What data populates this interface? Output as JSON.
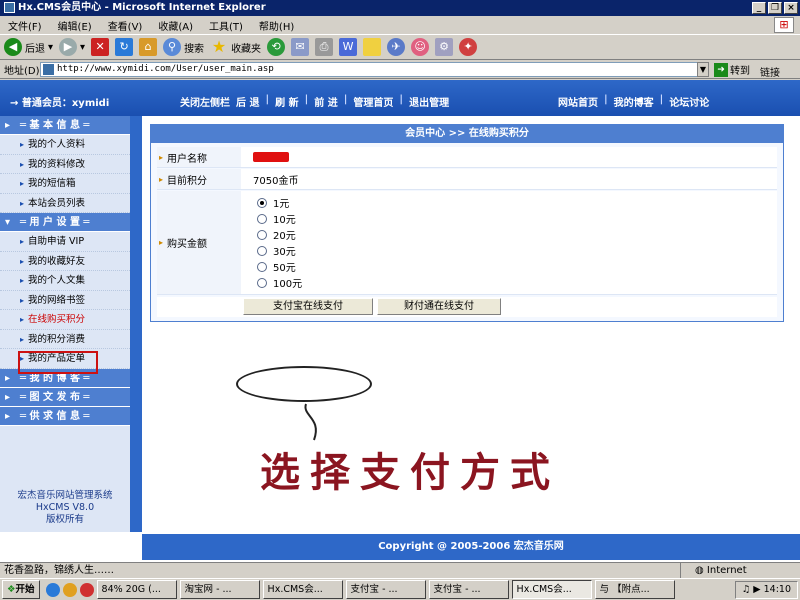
{
  "browser": {
    "title": "Hx.CMS会员中心 - Microsoft Internet Explorer",
    "menus": [
      "文件(F)",
      "编辑(E)",
      "查看(V)",
      "收藏(A)",
      "工具(T)",
      "帮助(H)"
    ],
    "toolbar": {
      "back": "后退",
      "search": "搜索",
      "favorites": "收藏夹"
    },
    "address_label": "地址(D)",
    "address": "http://www.xymidi.com/User/user_main.asp",
    "go": "转到",
    "links": "链接",
    "status": "花香盈路，锦绣人生……",
    "zone": "Internet"
  },
  "site": {
    "user_label": "→ 普通会员：xymidi",
    "nav_center": [
      "关闭左侧栏",
      "后 退",
      "刷 新",
      "前 进",
      "管理首页",
      "退出管理"
    ],
    "nav_right": [
      "网站首页",
      "我的博客",
      "论坛讨论"
    ],
    "sidebar": {
      "sections": [
        {
          "title": "═ 基 本 信 息 ═",
          "items": [
            "我的个人资料",
            "我的资料修改",
            "我的短信箱",
            "本站会员列表"
          ]
        },
        {
          "title": "═ 用 户 设 置 ═",
          "items": [
            "自助申请 VIP",
            "我的收藏好友",
            "我的个人文集",
            "我的网络书签",
            "在线购买积分",
            "我的积分消费",
            "我的产品定单"
          ]
        },
        {
          "title": "═ 我 的 博 客 ═",
          "items": []
        },
        {
          "title": "═ 图 文 发 布 ═",
          "items": []
        },
        {
          "title": "═ 供 求 信 息 ═",
          "items": []
        }
      ],
      "credits": [
        "宏杰音乐网站管理系统",
        "HxCMS V8.0",
        "版权所有"
      ]
    },
    "main": {
      "header": "会员中心 >> 在线购买积分",
      "username_label": "用户名称",
      "points_label": "目前积分",
      "points_value": "7050金币",
      "amount_label": "购买金额",
      "amounts": [
        "1元",
        "10元",
        "20元",
        "30元",
        "50元",
        "100元"
      ],
      "selected_amount": "1元",
      "pay_alipay": "支付宝在线支付",
      "pay_tenpay": "财付通在线支付"
    },
    "annotation": "选择支付方式",
    "footer": "Copyright @ 2005-2006 宏杰音乐网"
  },
  "taskbar": {
    "start": "开始",
    "tasks": [
      "84% 20G (...",
      "淘宝网 - ...",
      "Hx.CMS会...",
      "支付宝 - ...",
      "支付宝 - ...",
      "Hx.CMS会...",
      "与 【附点..."
    ],
    "active_index": 5,
    "clock": "14:10"
  },
  "colors": {
    "nav_blue": "#2e68c8",
    "highlight_red": "#cc1111",
    "annotation_red": "#8b1520"
  }
}
